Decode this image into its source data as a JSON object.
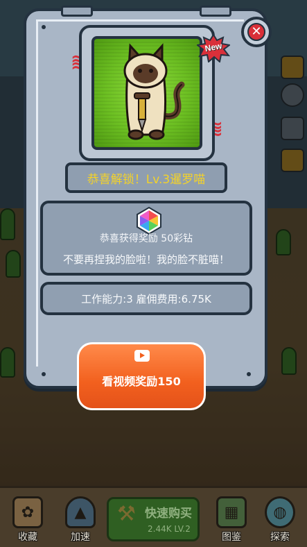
{
  "modal": {
    "new_badge": "New",
    "unlock_title": "恭喜解锁！Lv.3暹罗喵",
    "reward_text": "恭喜获得奖励 50彩钻",
    "cat_quote": "不要再捏我的脸啦！我的脸不脏喵！",
    "stats_text": "工作能力:3 雇佣费用:6.75K",
    "video_button_label": "看视频奖励150"
  },
  "bottom_bar": {
    "items": [
      {
        "label": "收藏",
        "icon": "collection-icon"
      },
      {
        "label": "加速",
        "icon": "rocket-icon"
      },
      {
        "label": "图鉴",
        "icon": "encyclopedia-icon"
      },
      {
        "label": "探索",
        "icon": "planet-icon"
      }
    ],
    "quick_buy": {
      "title": "快速购买",
      "subtitle": "2.44K LV.2"
    }
  },
  "colors": {
    "panel": "#a9b6c6",
    "outline": "#243240",
    "title_text": "#f3d22a",
    "video_button": "#f2601e",
    "close_red": "#d92f38",
    "portrait_green": "#6cbf22"
  }
}
